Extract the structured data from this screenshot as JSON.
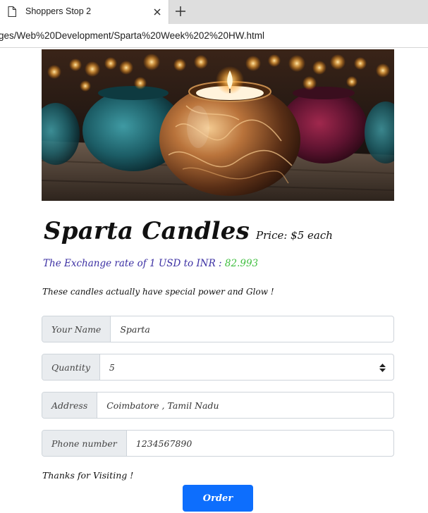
{
  "browser": {
    "tab_title": "Shoppers Stop 2",
    "url": "ges/Web%20Development/Sparta%20Week%202%20HW.html"
  },
  "page": {
    "hero_image": "candle-jars-photo",
    "brand": "Sparta Candles",
    "price": "Price: $5 each",
    "exchange_label": "The Exchange rate of 1 USD to INR : ",
    "exchange_value": "82.993",
    "tagline": "These candles actually have special power and Glow !",
    "form": {
      "name_label": "Your Name",
      "name_value": "Sparta",
      "quantity_label": "Quantity",
      "quantity_value": "5",
      "address_label": "Address",
      "address_value": "Coimbatore , Tamil Nadu",
      "phone_label": "Phone number",
      "phone_value": "1234567890"
    },
    "thanks": "Thanks for Visiting !",
    "order_button": "Order"
  },
  "colors": {
    "accent_blue": "#0d6efd",
    "exchange_text": "#3b2fa3",
    "rate_green": "#3fbf3f",
    "input_label_bg": "#e9ecef"
  }
}
